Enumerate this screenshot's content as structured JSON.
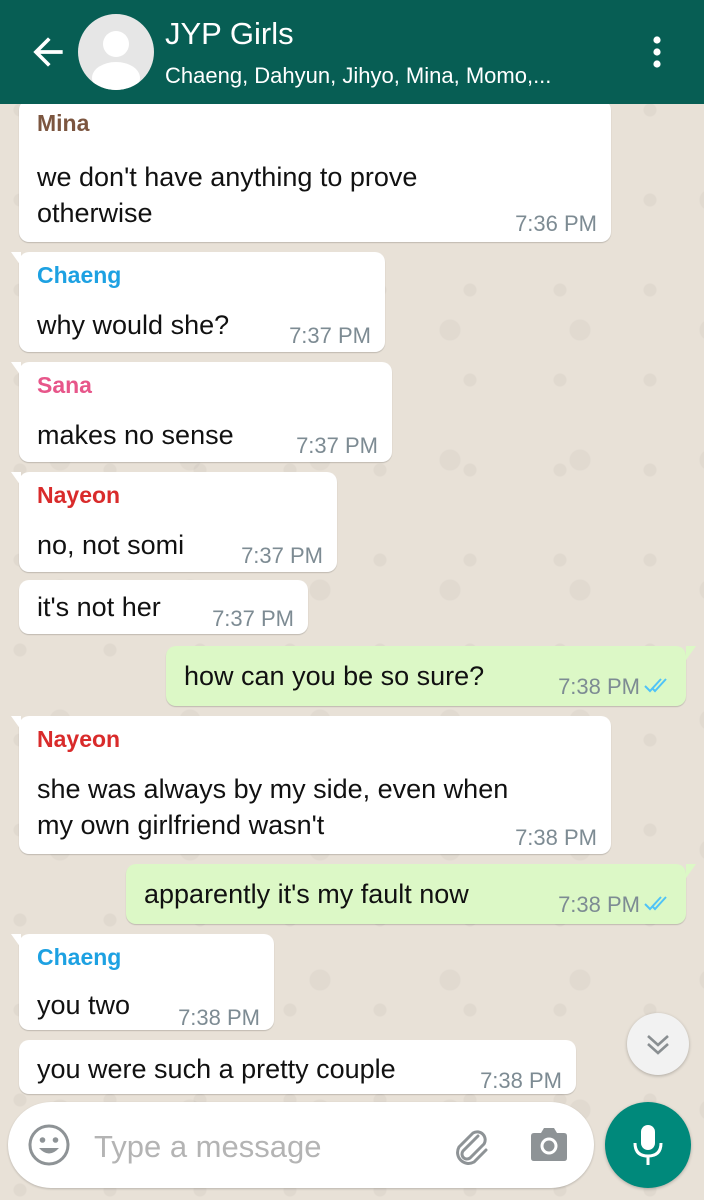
{
  "header": {
    "title": "JYP Girls",
    "subtitle": "Chaeng, Dahyun, Jihyo, Mina, Momo,...",
    "color": "#075e54"
  },
  "colors": {
    "incoming_bubble": "#ffffff",
    "outgoing_bubble": "#dcf8c6",
    "read_tick": "#4fc3f7",
    "mic_button": "#00897b"
  },
  "messages": [
    {
      "sender": "Mina",
      "sender_color": "#7c5640",
      "lines": [
        "we don't have anything to prove",
        "otherwise"
      ],
      "time": "7:36 PM"
    },
    {
      "sender": "Chaeng",
      "sender_color": "#1da1e2",
      "lines": [
        "why would she?"
      ],
      "time": "7:37 PM"
    },
    {
      "sender": "Sana",
      "sender_color": "#e7568a",
      "lines": [
        "makes no sense"
      ],
      "time": "7:37 PM"
    },
    {
      "sender": "Nayeon",
      "sender_color": "#d92b2b",
      "lines": [
        "no, not somi"
      ],
      "time": "7:37 PM"
    },
    {
      "lines": [
        "it's not her"
      ],
      "time": "7:37 PM"
    },
    {
      "outgoing": true,
      "lines": [
        "how can you be so sure?"
      ],
      "time": "7:38 PM",
      "status": "read"
    },
    {
      "sender": "Nayeon",
      "sender_color": "#d92b2b",
      "lines": [
        "she was always by my side, even when",
        "my own girlfriend wasn't"
      ],
      "time": "7:38 PM"
    },
    {
      "outgoing": true,
      "lines": [
        "apparently it's my fault now"
      ],
      "time": "7:38 PM",
      "status": "read"
    },
    {
      "sender": "Chaeng",
      "sender_color": "#1da1e2",
      "lines": [
        "you two"
      ],
      "time": "7:38 PM"
    },
    {
      "lines": [
        "you were such a pretty couple"
      ],
      "time": "7:38 PM"
    }
  ],
  "input": {
    "placeholder": "Type a message"
  },
  "icons": {
    "back": "arrow-left-icon",
    "menu": "more-vert-icon",
    "emoji": "emoji-icon",
    "attach": "paperclip-icon",
    "camera": "camera-icon",
    "mic": "mic-icon",
    "scroll": "chevron-double-down-icon"
  }
}
